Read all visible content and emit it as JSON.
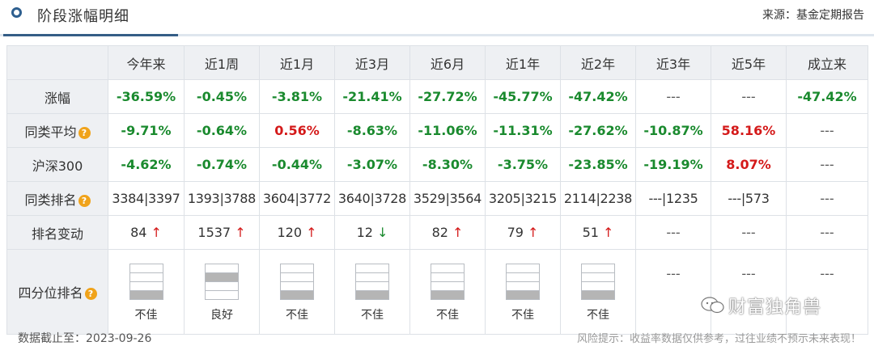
{
  "header": {
    "title": "阶段涨幅明细",
    "source": "来源：基金定期报告"
  },
  "columns": [
    "今年来",
    "近1周",
    "近1月",
    "近3月",
    "近6月",
    "近1年",
    "近2年",
    "近3年",
    "近5年",
    "成立来"
  ],
  "rows": {
    "gain": {
      "label": "涨幅",
      "values": [
        "-36.59%",
        "-0.45%",
        "-3.81%",
        "-21.41%",
        "-27.72%",
        "-45.77%",
        "-47.42%",
        "---",
        "---",
        "-47.42%"
      ]
    },
    "peer_avg": {
      "label": "同类平均",
      "values": [
        "-9.71%",
        "-0.64%",
        "0.56%",
        "-8.63%",
        "-11.06%",
        "-11.31%",
        "-27.62%",
        "-10.87%",
        "58.16%",
        "---"
      ]
    },
    "hs300": {
      "label": "沪深300",
      "values": [
        "-4.62%",
        "-0.74%",
        "-0.44%",
        "-3.07%",
        "-8.30%",
        "-3.75%",
        "-23.85%",
        "-19.19%",
        "8.07%",
        "---"
      ]
    },
    "peer_rank": {
      "label": "同类排名",
      "values": [
        "3384|3397",
        "1393|3788",
        "3604|3772",
        "3640|3728",
        "3529|3564",
        "3205|3215",
        "2114|2238",
        "---|1235",
        "---|573",
        "---"
      ]
    },
    "rank_change": {
      "label": "排名变动",
      "values": [
        "84",
        "1537",
        "120",
        "12",
        "82",
        "79",
        "51",
        "---",
        "---",
        "---"
      ],
      "directions": [
        "up",
        "up",
        "up",
        "down",
        "up",
        "up",
        "up",
        "",
        "",
        ""
      ]
    },
    "quartile": {
      "label": "四分位排名",
      "labels": [
        "不佳",
        "良好",
        "不佳",
        "不佳",
        "不佳",
        "不佳",
        "不佳",
        "---",
        "---",
        "---"
      ],
      "level": [
        1,
        3,
        1,
        1,
        1,
        1,
        1,
        0,
        0,
        0
      ]
    }
  },
  "footer": {
    "date": "数据截止至：2023-09-26",
    "risk": "风险提示：收益率数据仅供参考，过往业绩不预示未来表现！"
  },
  "watermark": "财富独角兽",
  "colors": {
    "negative": "#1a8a2e",
    "positive": "#d41a1a",
    "accent": "#2e5f8f"
  }
}
